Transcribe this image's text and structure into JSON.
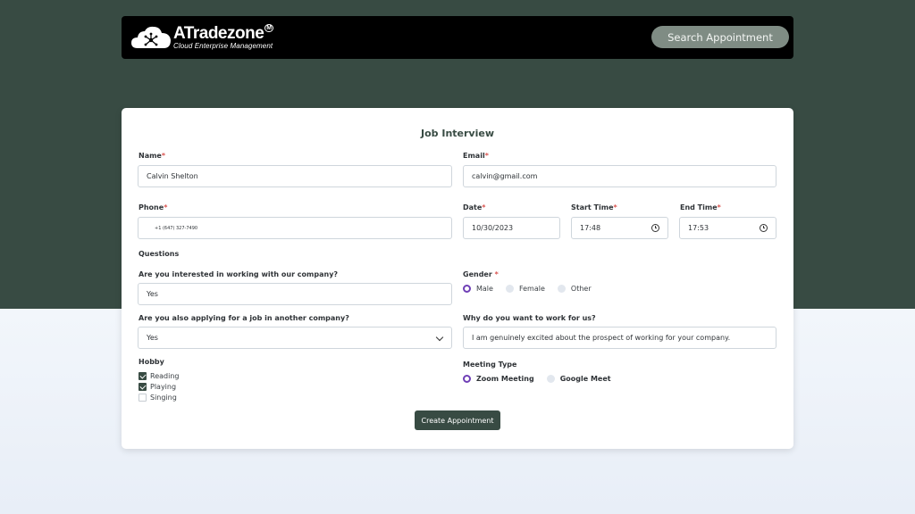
{
  "header": {
    "logo_main": "ATradezone",
    "logo_tm": "M",
    "logo_sub": "Cloud Enterprise Management",
    "search_button": "Search Appointment"
  },
  "form": {
    "title": "Job Interview",
    "name": {
      "label": "Name",
      "required": "*",
      "value": "Calvin Shelton"
    },
    "email": {
      "label": "Email",
      "required": "*",
      "value": "calvin@gmail.com"
    },
    "phone": {
      "label": "Phone",
      "required": "*",
      "value": "+1 (647) 327-7490"
    },
    "date": {
      "label": "Date",
      "required": "*",
      "value": "10/30/2023"
    },
    "start_time": {
      "label": "Start Time",
      "required": "*",
      "value": "17:48"
    },
    "end_time": {
      "label": "End Time",
      "required": "*",
      "value": "17:53"
    },
    "questions_heading": "Questions",
    "q_interested": {
      "label": "Are you interested in working with our company?",
      "value": "Yes"
    },
    "gender": {
      "label": "Gender",
      "required": " *",
      "options": [
        "Male",
        "Female",
        "Other"
      ],
      "selected": "Male"
    },
    "q_other_company": {
      "label": "Are you also applying for a job in another company?",
      "value": "Yes"
    },
    "q_why": {
      "label": "Why do you want to work for us?",
      "value": "I am genuinely excited about the prospect of working for your company."
    },
    "hobby": {
      "label": "Hobby",
      "options": [
        {
          "label": "Reading",
          "checked": true
        },
        {
          "label": "Playing",
          "checked": true
        },
        {
          "label": "Singing",
          "checked": false
        }
      ]
    },
    "meeting_type": {
      "label": "Meeting Type",
      "options": [
        "Zoom Meeting",
        "Google Meet"
      ],
      "selected": "Zoom Meeting"
    },
    "submit_label": "Create Appointment"
  },
  "colors": {
    "primary": "#384b43",
    "accent_radio": "#6f3fb6",
    "required": "#d9534f",
    "search_button_bg": "#7f8c84"
  }
}
